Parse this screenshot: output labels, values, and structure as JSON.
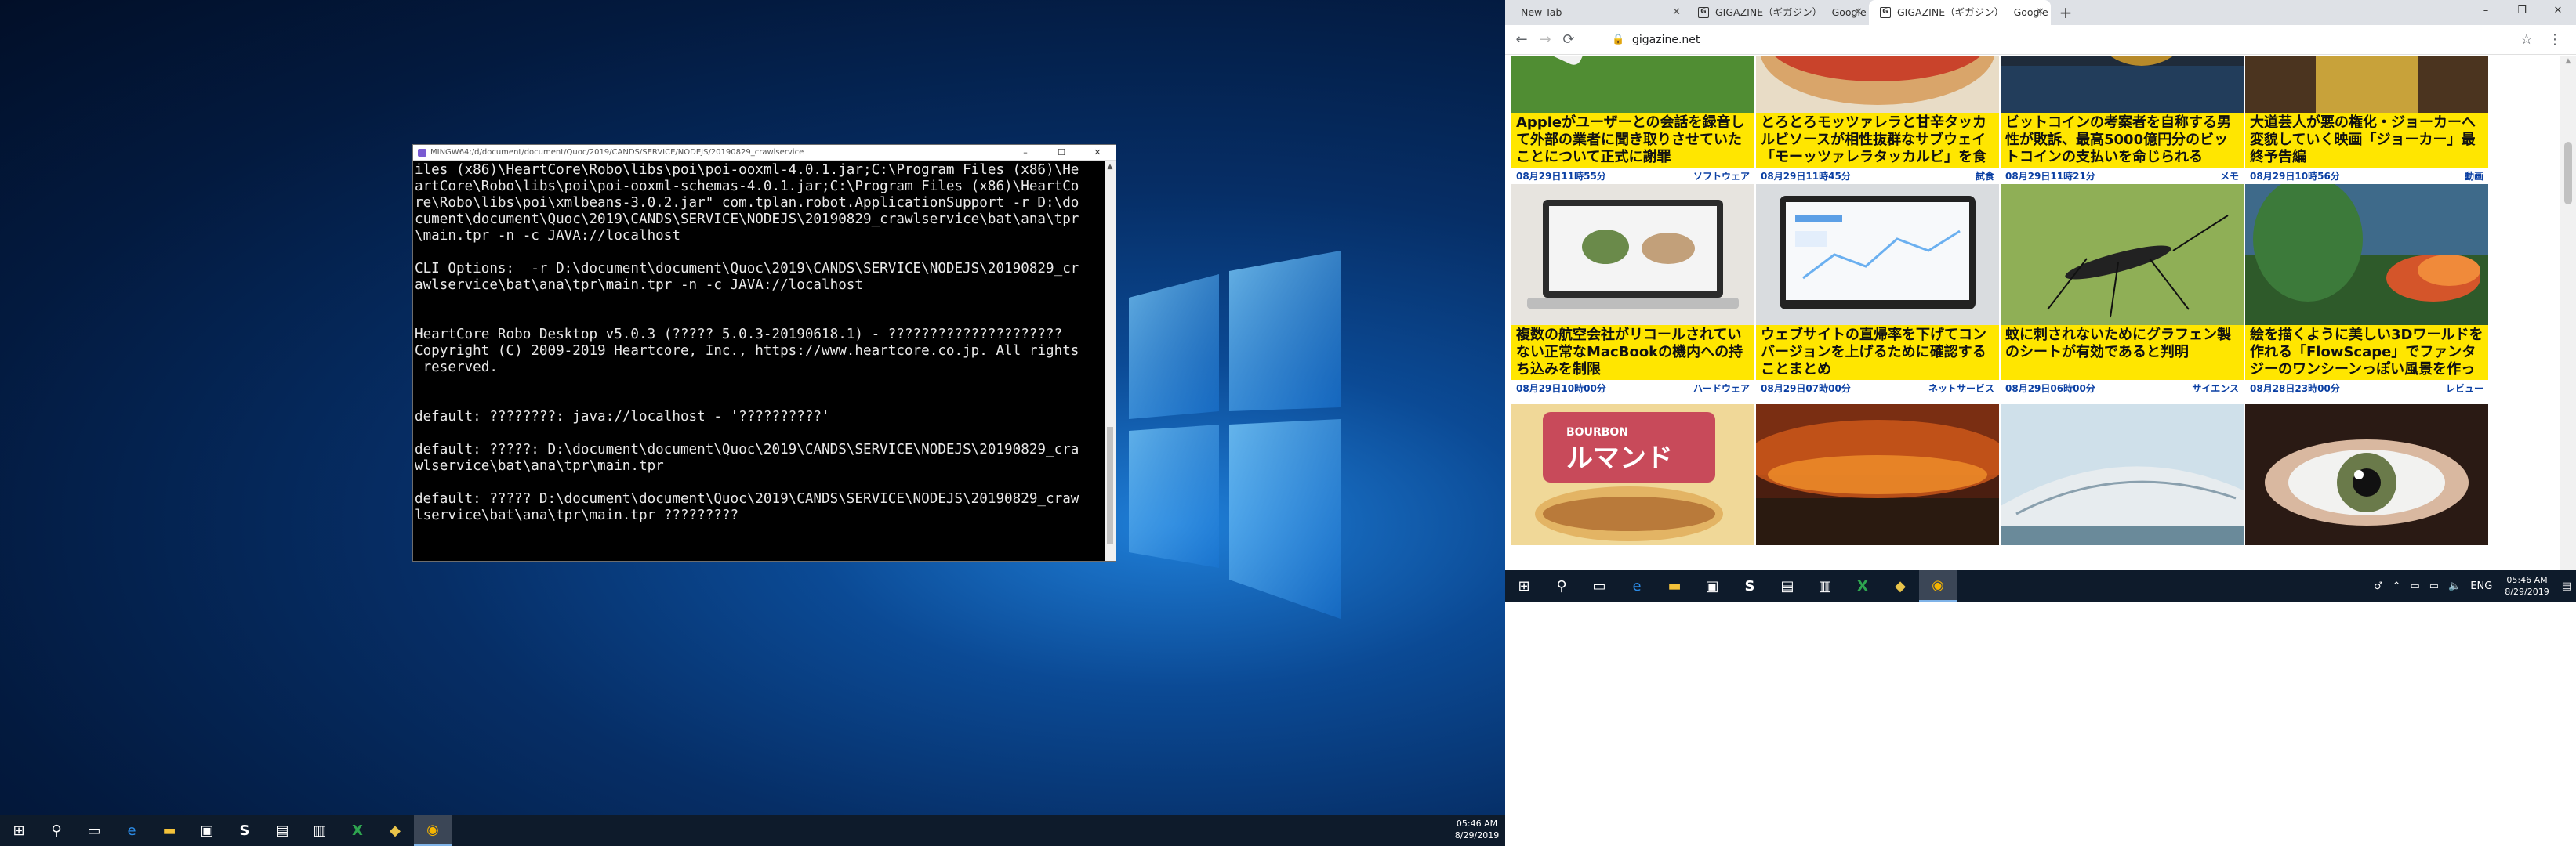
{
  "terminal": {
    "title": "MINGW64:/d/document/document/Quoc/2019/CANDS/SERVICE/NODEJS/20190829_crawlservice",
    "controls": [
      "–",
      "☐",
      "✕"
    ],
    "lines": [
      "iles (x86)\\HeartCore\\Robo\\libs\\poi\\poi-ooxml-4.0.1.jar;C:\\Program Files (x86)\\He",
      "artCore\\Robo\\libs\\poi\\poi-ooxml-schemas-4.0.1.jar;C:\\Program Files (x86)\\HeartCo",
      "re\\Robo\\libs\\poi\\xmlbeans-3.0.2.jar\" com.tplan.robot.ApplicationSupport -r D:\\do",
      "cument\\document\\Quoc\\2019\\CANDS\\SERVICE\\NODEJS\\20190829_crawlservice\\bat\\ana\\tpr",
      "\\main.tpr -n -c JAVA://localhost",
      "",
      "CLI Options:  -r D:\\document\\document\\Quoc\\2019\\CANDS\\SERVICE\\NODEJS\\20190829_cr",
      "awlservice\\bat\\ana\\tpr\\main.tpr -n -c JAVA://localhost",
      "",
      "",
      "HeartCore Robo Desktop v5.0.3 (????? 5.0.3-20190618.1) - ?????????????????????",
      "Copyright (C) 2009-2019 Heartcore, Inc., https://www.heartcore.co.jp. All rights",
      " reserved.",
      "",
      "",
      "default: ????????: java://localhost - '??????????'",
      "",
      "default: ?????: D:\\document\\document\\Quoc\\2019\\CANDS\\SERVICE\\NODEJS\\20190829_cra",
      "wlservice\\bat\\ana\\tpr\\main.tpr",
      "",
      "default: ????? D:\\document\\document\\Quoc\\2019\\CANDS\\SERVICE\\NODEJS\\20190829_craw",
      "lservice\\bat\\ana\\tpr\\main.tpr ?????????"
    ]
  },
  "taskbar_left": {
    "time": "05:46 AM",
    "date": "8/29/2019",
    "items": [
      {
        "name": "start-button",
        "glyph": "⊞"
      },
      {
        "name": "search-icon",
        "glyph": "⚲"
      },
      {
        "name": "task-view-icon",
        "glyph": "▭"
      },
      {
        "name": "edge-icon",
        "glyph": "e"
      },
      {
        "name": "file-explorer-icon",
        "glyph": "▬"
      },
      {
        "name": "remote-desktop-icon",
        "glyph": "▣"
      },
      {
        "name": "skype-icon",
        "glyph": "S"
      },
      {
        "name": "app-icon-1",
        "glyph": "▤"
      },
      {
        "name": "notepad-icon",
        "glyph": "▥"
      },
      {
        "name": "excel-icon",
        "glyph": "X"
      },
      {
        "name": "git-icon",
        "glyph": "◆"
      },
      {
        "name": "chrome-icon",
        "glyph": "◉"
      }
    ]
  },
  "browser": {
    "tabs": [
      {
        "label": "New Tab",
        "active": false
      },
      {
        "label": "GIGAZINE（ギガジン） - Google",
        "active": false
      },
      {
        "label": "GIGAZINE（ギガジン） - Google",
        "active": true
      }
    ],
    "new_tab": "+",
    "window_controls": [
      "–",
      "❐",
      "✕"
    ],
    "address": "gigazine.net",
    "nav": {
      "back": "←",
      "forward": "→",
      "reload": "⟳",
      "star": "☆",
      "menu": "⋮"
    }
  },
  "articles": [
    {
      "title": "Appleがユーザーとの会話を録音して外部の業者に聞き取りさせていたことについて正式に謝罪",
      "time": "08月29日11時55分",
      "category": "ソフトウェア",
      "thumb": "hand-phone"
    },
    {
      "title": "とろとろモッツァレラと甘辛タッカルビソースが相性抜群なサブウェイ「モーッツァレラタッカルビ」を食",
      "time": "08月29日11時45分",
      "category": "試食",
      "thumb": "sandwich"
    },
    {
      "title": "ビットコインの考案者を自称する男性が敗訴、最高5000億円分のビットコインの支払いを命じられる",
      "time": "08月29日11時21分",
      "category": "メモ",
      "thumb": "bitcoin"
    },
    {
      "title": "大道芸人が悪の権化・ジョーカーへ変貌していく映画「ジョーカー」最終予告編",
      "time": "08月29日10時56分",
      "category": "動画",
      "thumb": "joker"
    },
    {
      "title": "複数の航空会社がリコールされていない正常なMacBookの機内への持ち込みを制限",
      "time": "08月29日10時00分",
      "category": "ハードウェア",
      "thumb": "laptop"
    },
    {
      "title": "ウェブサイトの直帰率を下げてコンバージョンを上げるために確認することまとめ",
      "time": "08月29日07時00分",
      "category": "ネットサービス",
      "thumb": "analytics"
    },
    {
      "title": "蚊に刺されないためにグラフェン製のシートが有効であると判明",
      "time": "08月29日06時00分",
      "category": "サイエンス",
      "thumb": "mosquito"
    },
    {
      "title": "絵を描くように美しい3Dワールドを作れる「FlowScape」でファンタジーのワンシーンっぽい風景を作っ",
      "time": "08月28日23時00分",
      "category": "レビュー",
      "thumb": "fantasy"
    },
    {
      "title": "",
      "time": "",
      "category": "",
      "thumb": "bourbon"
    },
    {
      "title": "",
      "time": "",
      "category": "",
      "thumb": "fire"
    },
    {
      "title": "",
      "time": "",
      "category": "",
      "thumb": "architecture"
    },
    {
      "title": "",
      "time": "",
      "category": "",
      "thumb": "eye"
    }
  ],
  "thumb_texts": {
    "bourbon": "BOURBON",
    "bourbon_sub": "ルマンド"
  },
  "taskbar_right": {
    "time": "05:46 AM",
    "date": "8/29/2019",
    "lang": "ENG",
    "tray": [
      "⌃",
      "▭",
      "▭",
      "🔈"
    ],
    "items": [
      {
        "name": "start-button",
        "glyph": "⊞"
      },
      {
        "name": "search-icon",
        "glyph": "⚲"
      },
      {
        "name": "task-view-icon",
        "glyph": "▭"
      },
      {
        "name": "edge-icon",
        "glyph": "e"
      },
      {
        "name": "file-explorer-icon",
        "glyph": "▬"
      },
      {
        "name": "remote-desktop-icon",
        "glyph": "▣"
      },
      {
        "name": "skype-icon",
        "glyph": "S"
      },
      {
        "name": "app-icon-1",
        "glyph": "▤"
      },
      {
        "name": "notepad-icon",
        "glyph": "▥"
      },
      {
        "name": "excel-icon",
        "glyph": "X"
      },
      {
        "name": "git-icon",
        "glyph": "◆"
      },
      {
        "name": "chrome-icon",
        "glyph": "◉"
      }
    ]
  },
  "colors": {
    "title_bg": "#ffe600",
    "meta_text": "#0a3fa3",
    "taskbar": "#0e1b2b"
  }
}
